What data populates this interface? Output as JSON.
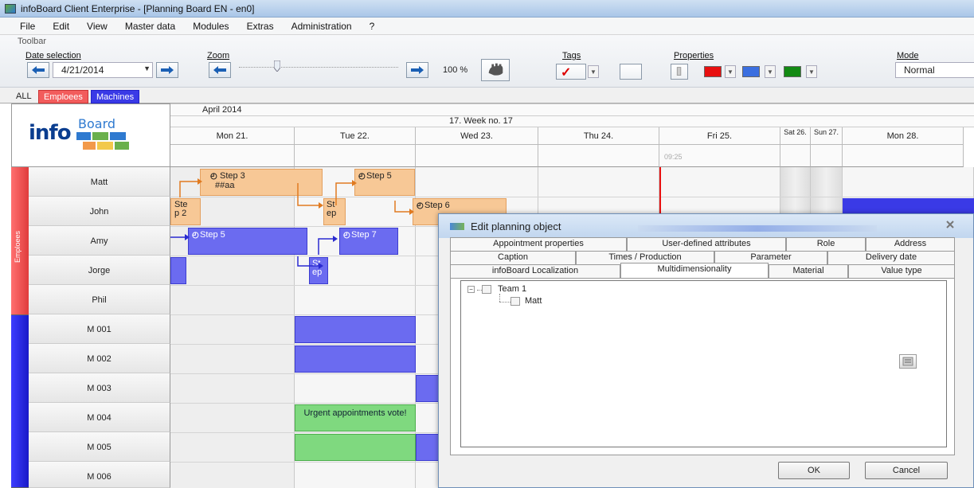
{
  "window": {
    "title": "infoBoard Client Enterprise - [Planning Board EN - en0]"
  },
  "menu": [
    "File",
    "Edit",
    "View",
    "Master data",
    "Modules",
    "Extras",
    "Administration",
    "?"
  ],
  "toolbar": {
    "caption": "Toolbar",
    "date_label": "Date selection",
    "date_value": "4/21/2014",
    "zoom_label": "Zoom",
    "zoom_value": "100 %",
    "zoom_level_percent": 100,
    "tags_label": "Tags",
    "tags_check": "✓",
    "properties_label": "Properties",
    "mode_label": "Mode",
    "mode_value": "Normal",
    "property_colors": [
      "#e81010",
      "#3b6fe0",
      "#138a13"
    ]
  },
  "view_tabs": [
    "ALL",
    "Emploees",
    "Machines"
  ],
  "board": {
    "month": "April 2014",
    "week": "17. Week no. 17",
    "days": [
      "Mon 21.",
      "Tue 22.",
      "Wed 23.",
      "Thu 24.",
      "Fri 25.",
      "Sat 26.",
      "Sun 27.",
      "Mon 28."
    ],
    "current_time": "09:25",
    "side_label_employees": "Emploees",
    "rows": [
      "Matt",
      "John",
      "Amy",
      "Jorge",
      "Phil",
      "M 001",
      "M 002",
      "M 003",
      "M 004",
      "M 005",
      "M 006"
    ],
    "tasks": {
      "matt_step3": "Step 3",
      "matt_step3_sub": "##aa",
      "matt_step5": "Step 5",
      "john_step2a": "Ste",
      "john_step2b": "p 2",
      "john_st_a": "St",
      "john_st_b": "ep",
      "john_step6": "Step 6",
      "amy_step5": "Step 5",
      "amy_step7": "Step 7",
      "jorge_st_a": "St",
      "jorge_st_b": "ep",
      "urgent": "Urgent appointments vote!"
    }
  },
  "dialog": {
    "title": "Edit planning object",
    "tabs_row1": [
      "Appointment properties",
      "User-defined attributes",
      "Role",
      "Address"
    ],
    "tabs_row2": [
      "Caption",
      "Times / Production",
      "Parameter",
      "Delivery date"
    ],
    "tabs_row3": [
      "infoBoard Localization",
      "Multidimensionality",
      "Material",
      "Value type"
    ],
    "active_tab": "Multidimensionality",
    "tree": {
      "root": "Team 1",
      "child": "Matt"
    },
    "ok": "OK",
    "cancel": "Cancel"
  },
  "colors": {
    "employees": "#ef5050",
    "machines": "#2a2ae0",
    "orange_task": "#f7c896",
    "blue_task": "#6b6bf0",
    "green_task": "#7fd97f"
  }
}
